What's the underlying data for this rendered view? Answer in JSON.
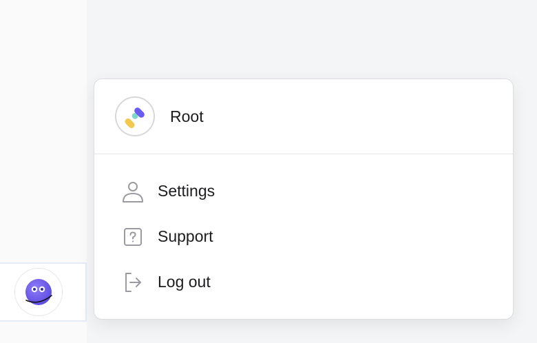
{
  "org": {
    "name": "Root",
    "logo_icon": "root-org-logo"
  },
  "user": {
    "avatar_icon": "user-avatar-purple-face"
  },
  "menu": {
    "items": [
      {
        "label": "Settings",
        "icon": "user-icon"
      },
      {
        "label": "Support",
        "icon": "question-icon"
      },
      {
        "label": "Log out",
        "icon": "logout-icon"
      }
    ]
  },
  "colors": {
    "accent_purple": "#6b5cf0",
    "logo_yellow": "#f2c94c",
    "logo_teal": "#7fd6c8",
    "icon_gray": "#9a9aa0",
    "text": "#1d1d1f"
  }
}
